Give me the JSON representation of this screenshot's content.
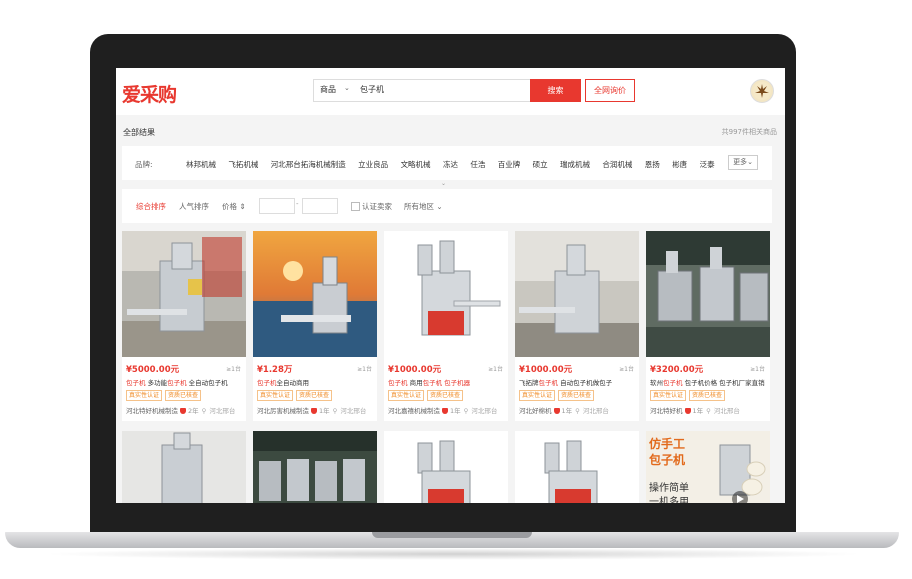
{
  "header": {
    "logo": "爱采购",
    "search_scope": "商品",
    "search_query": "包子机",
    "search_button": "搜索",
    "inquiry_button": "全网询价"
  },
  "results": {
    "label": "全部结果",
    "total": "共997件相关商品"
  },
  "brands": {
    "label": "品牌:",
    "items": [
      "林邦机械",
      "飞拓机械",
      "河北邢台拓海机械制造",
      "立业良品",
      "文略机械",
      "冻达",
      "任浩",
      "百业牌",
      "硕立",
      "瑞成机械",
      "合润机械",
      "恩扬",
      "彬唐",
      "泛泰"
    ],
    "more": "更多"
  },
  "filters": {
    "sort_default": "综合排序",
    "sort_popular": "人气排序",
    "price": "价格",
    "verified": "认证卖家",
    "region": "所有地区"
  },
  "products": [
    {
      "price": "¥5000.00元",
      "moq": "≥1台",
      "title_hl1": "包子机",
      "title_mid": " 多功能",
      "title_hl2": "包子机",
      "title_end": " 全自动包子机",
      "tags": [
        "真实性认证",
        "资质已核查"
      ],
      "seller": "河北特好机械制造",
      "years": "2年",
      "location": "河北邢台"
    },
    {
      "price": "¥1.28万",
      "moq": "≥1台",
      "title_hl1": "包子机",
      "title_mid": "全自动商用",
      "title_hl2": "",
      "title_end": "",
      "tags": [
        "真实性认证",
        "资质已核查"
      ],
      "seller": "河北厉害机械制造",
      "years": "1年",
      "location": "河北邢台"
    },
    {
      "price": "¥1000.00元",
      "moq": "≥1台",
      "title_hl1": "包子机",
      "title_mid": " 商用",
      "title_hl2": "包子机",
      "title_end": " 包子机器",
      "tags": [
        "真实性认证",
        "资质已核查"
      ],
      "seller": "河北嘉禧机械制造",
      "years": "1年",
      "location": "河北邢台"
    },
    {
      "price": "¥1000.00元",
      "moq": "≥1台",
      "title_hl1": "",
      "title_mid": "飞拓牌",
      "title_hl2": "包子机",
      "title_end": " 自动包子机做包子",
      "tags": [
        "真实性认证",
        "资质已核查"
      ],
      "seller": "河北好棉机",
      "years": "1年",
      "location": "河北邢台"
    },
    {
      "price": "¥3200.00元",
      "moq": "≥1台",
      "title_hl1": "",
      "title_mid": "软州",
      "title_hl2": "包子机",
      "title_end": " 包子机价格 包子机厂家直销",
      "tags": [
        "真实性认证",
        "资质已核查"
      ],
      "seller": "河北特好机",
      "years": "1年",
      "location": "河北邢台"
    }
  ],
  "promo": {
    "line1": "仿手工",
    "line2": "包子机",
    "line3": "操作简单",
    "line4": "一机多用"
  },
  "colors": {
    "accent": "#e8382f",
    "tag": "#f08a24"
  }
}
